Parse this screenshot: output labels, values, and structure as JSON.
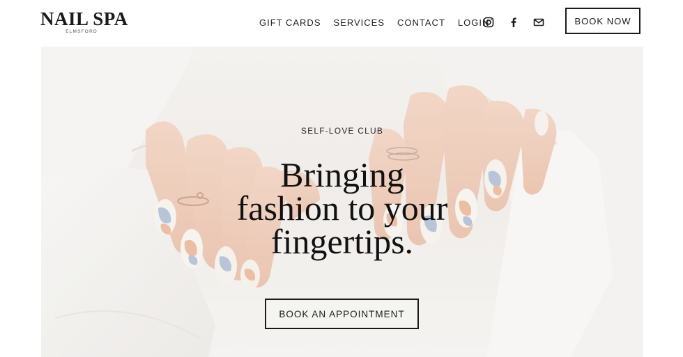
{
  "brand": {
    "name": "NAIL SPA",
    "location": "ELMSFORD"
  },
  "nav": {
    "items": [
      {
        "label": "GIFT CARDS"
      },
      {
        "label": "SERVICES"
      },
      {
        "label": "CONTACT"
      },
      {
        "label": "LOGIN"
      }
    ]
  },
  "social": [
    {
      "icon": "instagram-icon"
    },
    {
      "icon": "facebook-icon"
    },
    {
      "icon": "mail-icon"
    }
  ],
  "header": {
    "book_now_label": "BOOK NOW"
  },
  "hero": {
    "eyebrow": "SELF-LOVE CLUB",
    "headline_lines": [
      "Bringing",
      "fashion to your",
      "fingertips."
    ],
    "cta_label": "BOOK AN APPOINTMENT"
  },
  "colors": {
    "text": "#1a1a1a",
    "hero_bg": "#eeebe7",
    "skin": "#ebc3ad",
    "nail_blue": "#a9b7cf",
    "nail_peach": "#e8b08f"
  }
}
